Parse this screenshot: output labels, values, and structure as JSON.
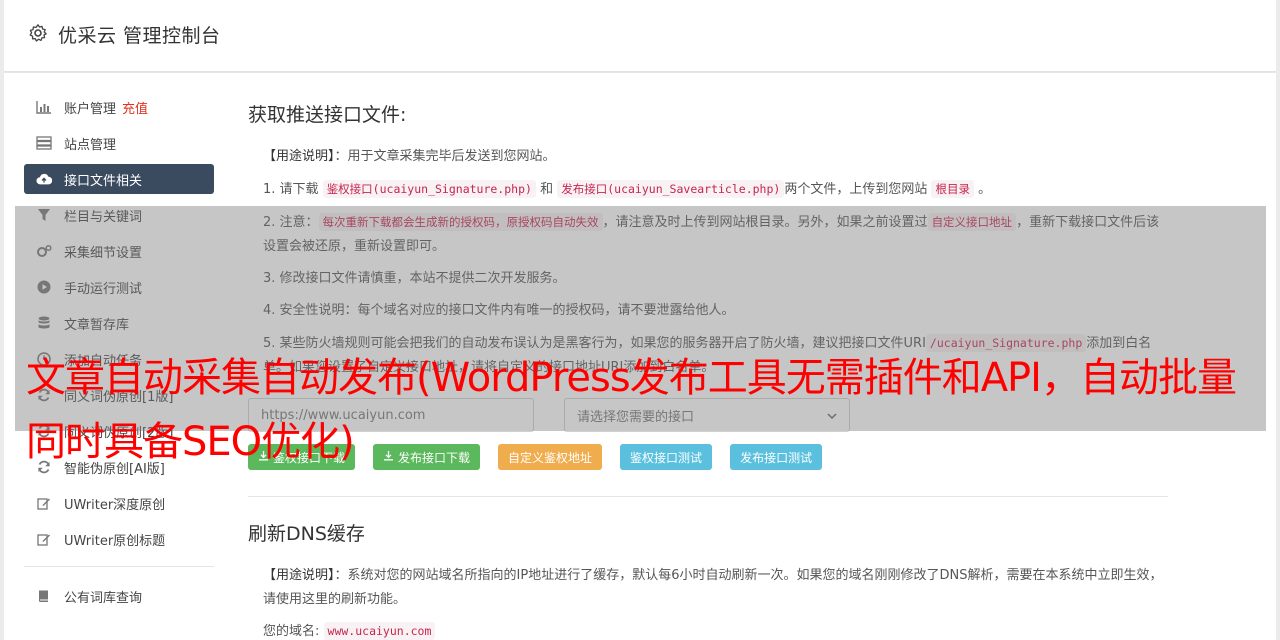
{
  "header": {
    "title": "优采云 管理控制台"
  },
  "sidebar": {
    "items": [
      {
        "label": "账户管理",
        "extra": "充值",
        "icon": "bar-chart-icon"
      },
      {
        "label": "站点管理",
        "icon": "server-icon"
      },
      {
        "label": "接口文件相关",
        "icon": "cloud-upload-icon"
      },
      {
        "label": "栏目与关键词",
        "icon": "filter-icon"
      },
      {
        "label": "采集细节设置",
        "icon": "cogs-icon"
      },
      {
        "label": "手动运行测试",
        "icon": "play-icon"
      },
      {
        "label": "文章暂存库",
        "icon": "database-icon"
      },
      {
        "label": "添加自动任务",
        "icon": "clock-icon"
      },
      {
        "label": "同义词伪原创[1版]",
        "icon": "refresh-icon"
      },
      {
        "label": "同义词伪原创[2版]",
        "icon": "refresh-icon"
      },
      {
        "label": "智能伪原创[AI版]",
        "icon": "refresh-icon"
      },
      {
        "label": "UWriter深度原创",
        "icon": "edit-icon"
      },
      {
        "label": "UWriter原创标题",
        "icon": "edit-icon"
      },
      {
        "label": "公有词库查询",
        "icon": "book-icon"
      }
    ]
  },
  "section1": {
    "title": "获取推送接口文件:",
    "usage_label": "【用途说明】",
    "usage_text": "：用于文章采集完毕后发送到您网站。",
    "p1_a": "1. 请下载",
    "p1_code1": "鉴权接口(ucaiyun_Signature.php)",
    "p1_b": "和",
    "p1_code2": "发布接口(ucaiyun_Savearticle.php)",
    "p1_c": "两个文件，上传到您网站",
    "p1_code3": "根目录",
    "p1_d": "。",
    "p2_a": "2. 注意：",
    "p2_code1": "每次重新下载都会生成新的授权码，原授权码自动失效",
    "p2_b": "，请注意及时上传到网站根目录。另外，如果之前设置过",
    "p2_code2": "自定义接口地址",
    "p2_c": "，重新下载接口文件后该设置会被还原，重新设置即可。",
    "p3": "3. 修改接口文件请慎重，本站不提供二次开发服务。",
    "p4": "4. 安全性说明：每个域名对应的接口文件内有唯一的授权码，请不要泄露给他人。",
    "p5_a": "5. 某些防火墙规则可能会把我们的自动发布误认为是黑客行为，如果您的服务器开启了防火墙，建议把接口文件URI",
    "p5_code": "/ucaiyun_Signature.php",
    "p5_b": "添加到白名单。如果您设置了自定义接口地址，请将自定义的接口地址URI添加到白名单。",
    "url_value": "https://www.ucaiyun.com",
    "select_placeholder": "请选择您需要的接口",
    "buttons": {
      "sign_download": "鉴权接口下载",
      "publish_download": "发布接口下载",
      "custom_sign": "自定义鉴权地址",
      "sign_test": "鉴权接口测试",
      "publish_test": "发布接口测试"
    }
  },
  "section2": {
    "title": "刷新DNS缓存",
    "usage_label": "【用途说明】",
    "usage_text": "：系统对您的网站域名所指向的IP地址进行了缓存，默认每6小时自动刷新一次。如果您的域名刚刚修改了DNS解析，需要在本系统中立即生效，请使用这里的刷新功能。",
    "domain_label": "您的域名:",
    "domain_value": "www.ucaiyun.com"
  },
  "banner": {
    "text": "文章自动采集自动发布(WordPress发布工具无需插件和API，自动批量同时具备SEO优化)"
  },
  "colors": {
    "active_nav": "#3a4a5f",
    "banner_red": "#ff0000",
    "recharge_red": "#e0321e",
    "btn_green": "#5cb85c",
    "btn_orange": "#f0ad4e",
    "btn_blue": "#5bc0de"
  }
}
